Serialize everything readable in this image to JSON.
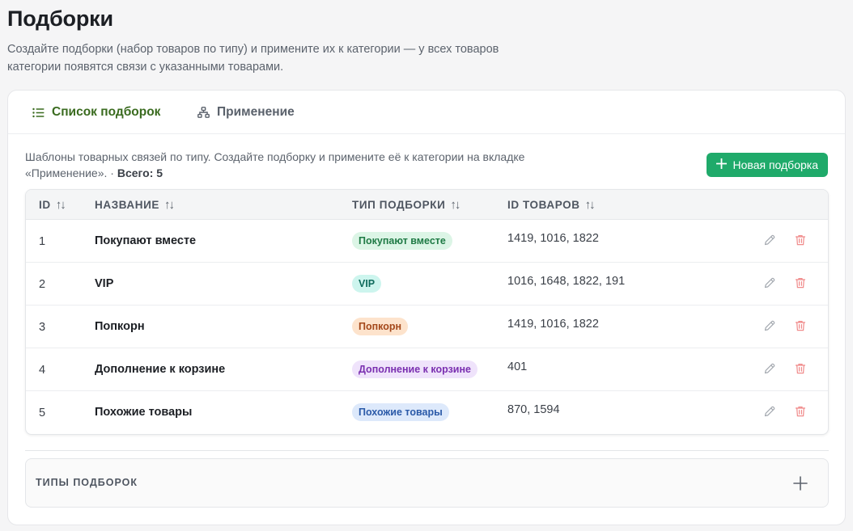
{
  "page": {
    "title": "Подборки",
    "description": "Создайте подборки (набор товаров по типу) и примените их к категории — у всех товаров категории появятся связи с указанными товарами."
  },
  "tabs": [
    {
      "label": "Список подборок",
      "icon": "list-icon",
      "active": true
    },
    {
      "label": "Применение",
      "icon": "sitemap-icon",
      "active": false
    }
  ],
  "intro": {
    "text": "Шаблоны товарных связей по типу. Создайте подборку и примените её к категории на вкладке «Применение». · ",
    "total": "Всего: 5"
  },
  "new_button": {
    "label": "Новая подборка",
    "icon": "plus-icon"
  },
  "table": {
    "columns": [
      {
        "label": "ID"
      },
      {
        "label": "НАЗВАНИЕ"
      },
      {
        "label": "ТИП ПОДБОРКИ"
      },
      {
        "label": "ID ТОВАРОВ"
      }
    ],
    "rows": [
      {
        "id": "1",
        "name": "Покупают вместе",
        "type": "Покупают вместе",
        "ids": "1419, 1016, 1822"
      },
      {
        "id": "2",
        "name": "VIP",
        "type": "VIP",
        "ids": "1016, 1648, 1822, 191"
      },
      {
        "id": "3",
        "name": "Попкорн",
        "type": "Попкорн",
        "ids": "1419, 1016, 1822"
      },
      {
        "id": "4",
        "name": "Дополнение к корзине",
        "type": "Дополнение к корзине",
        "ids": "401"
      },
      {
        "id": "5",
        "name": "Похожие товары",
        "type": "Похожие товары",
        "ids": "870, 1594"
      }
    ]
  },
  "badge_colors": [
    {
      "bg": "#dcf5e6",
      "fg": "#1f7a45"
    },
    {
      "bg": "#cdf5ee",
      "fg": "#0f6b5c"
    },
    {
      "bg": "#fde3cc",
      "fg": "#a4481a"
    },
    {
      "bg": "#efe3fb",
      "fg": "#7a2fb0"
    },
    {
      "bg": "#dde9fb",
      "fg": "#2b5aa8"
    }
  ],
  "types_section": {
    "label": "ТИПЫ ПОДБОРОК"
  },
  "colors": {
    "accent": "#1faa6a",
    "tab_active": "#3a6b1f",
    "delete": "#f08a8a"
  }
}
